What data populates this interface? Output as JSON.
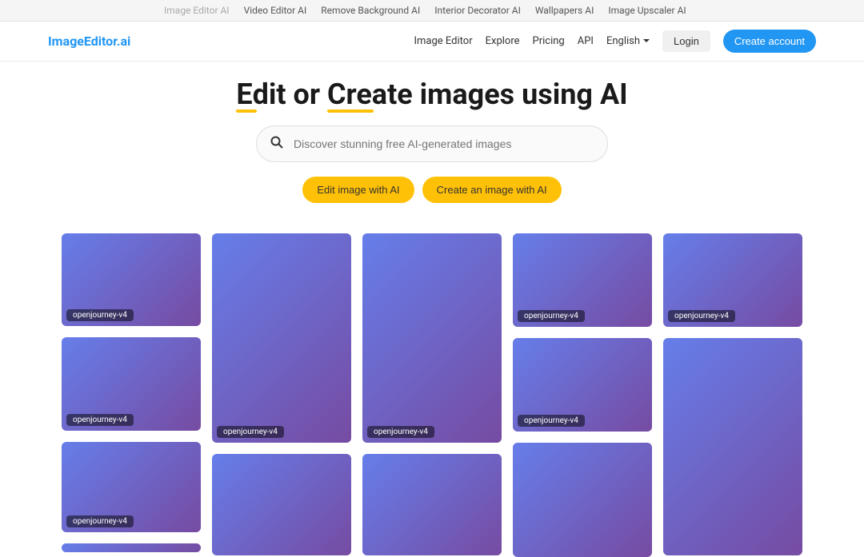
{
  "topNav": {
    "items": [
      {
        "label": "Image Editor AI",
        "active": true
      },
      {
        "label": "Video Editor AI",
        "active": false
      },
      {
        "label": "Remove Background AI",
        "active": false
      },
      {
        "label": "Interior Decorator AI",
        "active": false
      },
      {
        "label": "Wallpapers AI",
        "active": false
      },
      {
        "label": "Image Upscaler AI",
        "active": false
      }
    ]
  },
  "logo": "ImageEditor.ai",
  "mainNav": {
    "imageEditor": "Image Editor",
    "explore": "Explore",
    "pricing": "Pricing",
    "api": "API",
    "language": "English",
    "login": "Login",
    "createAccount": "Create account"
  },
  "hero": {
    "titlePrefix": "E",
    "titleMid1": "dit or ",
    "titleC": "C",
    "titleMid2": "reate",
    "titleSuffix": " images using AI"
  },
  "search": {
    "placeholder": "Discover stunning free AI-generated images"
  },
  "actions": {
    "edit": "Edit image with AI",
    "create": "Create an image with AI"
  },
  "gallery": {
    "label": "openjourney-v4"
  }
}
